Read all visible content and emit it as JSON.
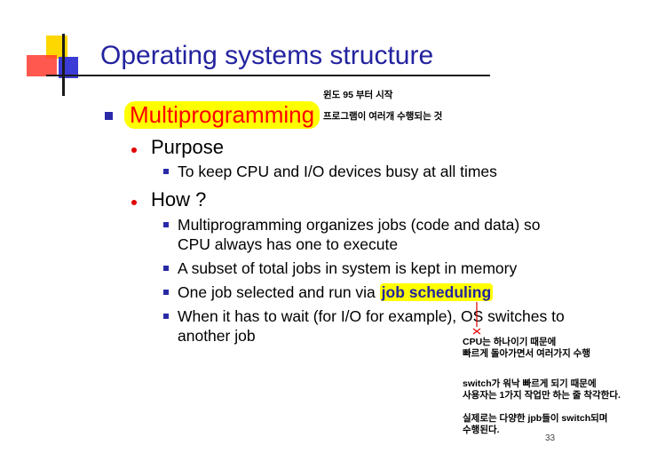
{
  "slide": {
    "title": "Operating systems structure",
    "main_bullet": "Multiprogramming",
    "sections": [
      {
        "heading": "Purpose",
        "items": [
          "To keep CPU and I/O devices busy at all times"
        ]
      },
      {
        "heading": "How ?",
        "items": [
          "Multiprogramming organizes jobs (code and data) so",
          "CPU always has one to execute",
          "A subset of total jobs in system is kept in memory",
          "One job selected and run via",
          "job scheduling",
          "When it has to wait (for I/O for example), OS switches to",
          "another job"
        ]
      }
    ],
    "page_number": "33"
  },
  "annotations": {
    "top_1": "윈도 95 부터 시작",
    "top_2": "프로그램이 여러개 수행되는 것",
    "cpu_1": "CPU는 하나이기 때문에",
    "cpu_2": "빠르게 돌아가면서 여러가지 수행",
    "switch_1": "switch가 워낙 빠르게 되기 때문에",
    "switch_2": "사용자는 1가지 작업만 하는 줄 착각한다.",
    "real_1": "실제로는 다양한 jpb들이 switch되며",
    "real_2": "수행된다."
  },
  "colors": {
    "title": "#2323a0",
    "highlight": "#ffff00",
    "main_bullet_text": "#ff0000",
    "bullet_dot": "#e00000",
    "bullet_square": "#2a2aa8"
  }
}
